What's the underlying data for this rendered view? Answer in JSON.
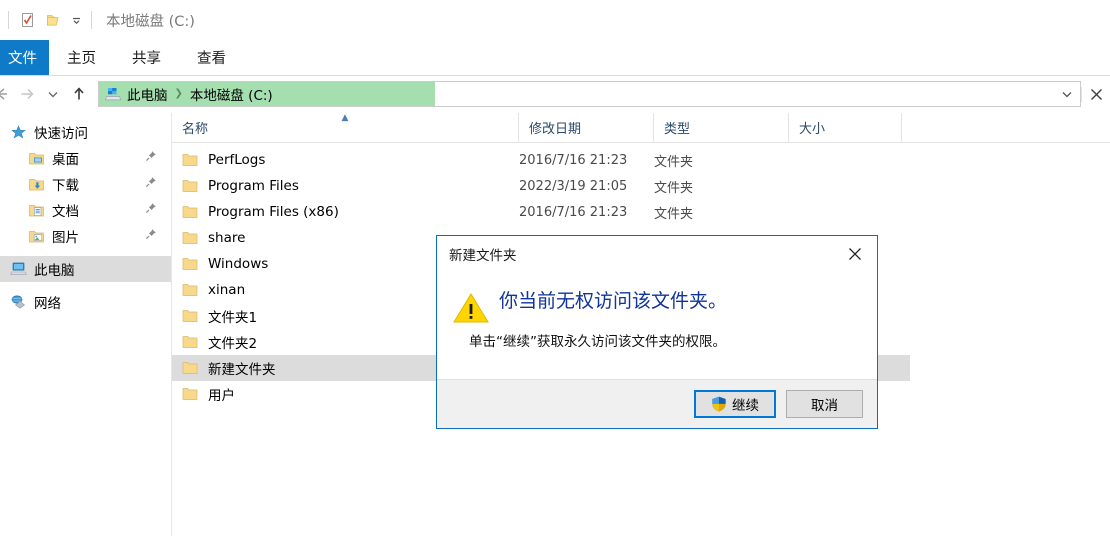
{
  "window": {
    "title": "本地磁盘 (C:)",
    "quick_access_toolbar": [
      {
        "name": "properties-icon",
        "label": "属性"
      },
      {
        "name": "new-folder-icon",
        "label": "新建文件夹"
      },
      {
        "name": "customize-chevron-icon",
        "label": "自定义快速访问工具栏"
      }
    ]
  },
  "ribbon": {
    "tabs": [
      {
        "label": "文件",
        "active": true
      },
      {
        "label": "主页",
        "active": false
      },
      {
        "label": "共享",
        "active": false
      },
      {
        "label": "查看",
        "active": false
      }
    ]
  },
  "navigation": {
    "back_label": "后退",
    "forward_label": "前进",
    "recent_label": "最近浏览的位置",
    "up_label": "上一级",
    "breadcrumb": [
      {
        "label": "此电脑"
      },
      {
        "label": "本地磁盘 (C:)"
      }
    ],
    "breadcrumb_highlight_color": "#a5dfb0",
    "dropdown_label": "以前的位置",
    "stop_label": "停止"
  },
  "sidebar": {
    "items": [
      {
        "label": "快速访问",
        "icon": "star-icon",
        "indent": false,
        "pinned": false,
        "selected": false
      },
      {
        "label": "桌面",
        "icon": "desktop-folder-icon",
        "indent": true,
        "pinned": true,
        "selected": false
      },
      {
        "label": "下载",
        "icon": "downloads-folder-icon",
        "indent": true,
        "pinned": true,
        "selected": false
      },
      {
        "label": "文档",
        "icon": "documents-folder-icon",
        "indent": true,
        "pinned": true,
        "selected": false
      },
      {
        "label": "图片",
        "icon": "pictures-folder-icon",
        "indent": true,
        "pinned": true,
        "selected": false
      },
      {
        "label": "此电脑",
        "icon": "this-pc-icon",
        "indent": false,
        "pinned": false,
        "selected": true
      },
      {
        "label": "网络",
        "icon": "network-icon",
        "indent": false,
        "pinned": false,
        "selected": false
      }
    ]
  },
  "file_list": {
    "columns": [
      {
        "label": "名称",
        "sorted": "asc"
      },
      {
        "label": "修改日期",
        "sorted": ""
      },
      {
        "label": "类型",
        "sorted": ""
      },
      {
        "label": "大小",
        "sorted": ""
      }
    ],
    "rows": [
      {
        "name": "PerfLogs",
        "date": "2016/7/16 21:23",
        "type": "文件夹",
        "size": "",
        "selected": false
      },
      {
        "name": "Program Files",
        "date": "2022/3/19 21:05",
        "type": "文件夹",
        "size": "",
        "selected": false
      },
      {
        "name": "Program Files (x86)",
        "date": "2016/7/16 21:23",
        "type": "文件夹",
        "size": "",
        "selected": false
      },
      {
        "name": "share",
        "date": "",
        "type": "",
        "size": "",
        "selected": false
      },
      {
        "name": "Windows",
        "date": "",
        "type": "",
        "size": "",
        "selected": false
      },
      {
        "name": "xinan",
        "date": "",
        "type": "",
        "size": "",
        "selected": false
      },
      {
        "name": "文件夹1",
        "date": "",
        "type": "",
        "size": "",
        "selected": false
      },
      {
        "name": "文件夹2",
        "date": "",
        "type": "",
        "size": "",
        "selected": false
      },
      {
        "name": "新建文件夹",
        "date": "",
        "type": "",
        "size": "",
        "selected": true
      },
      {
        "name": "用户",
        "date": "",
        "type": "",
        "size": "",
        "selected": false
      }
    ]
  },
  "dialog": {
    "title": "新建文件夹",
    "close_label": "关闭",
    "icon": "warning-triangle-icon",
    "headline": "你当前无权访问该文件夹。",
    "message": "单击“继续”获取永久访问该文件夹的权限。",
    "buttons": [
      {
        "label": "继续",
        "default": true,
        "shield": true,
        "name": "continue-button"
      },
      {
        "label": "取消",
        "default": false,
        "shield": false,
        "name": "cancel-button"
      }
    ],
    "border_color": "#0b6ebd",
    "headline_color": "#11339b"
  }
}
